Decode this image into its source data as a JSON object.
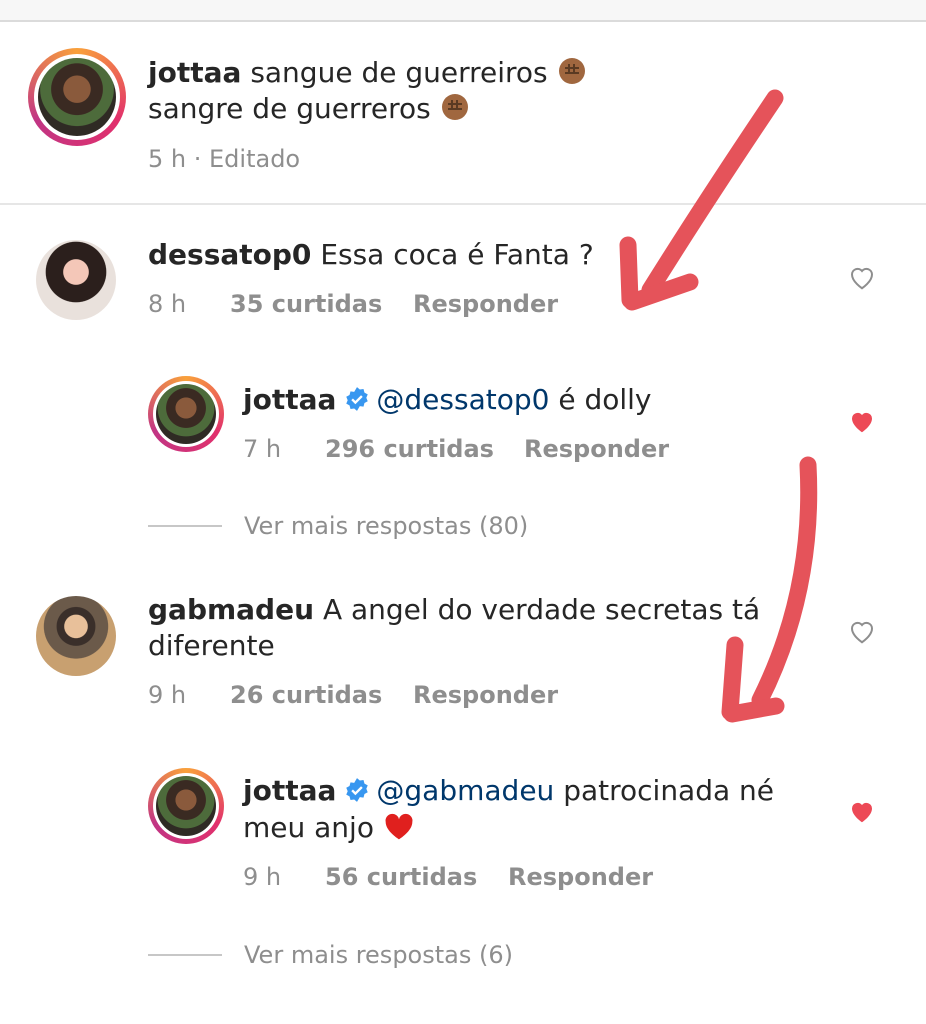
{
  "caption": {
    "username": "jottaa",
    "line1": "sangue de guerreiros",
    "line2": "sangre de guerreros",
    "time": "5 h",
    "edited": "· Editado"
  },
  "comments": [
    {
      "username": "dessatop0",
      "text": "Essa coca é Fanta ?",
      "time": "8 h",
      "likes": "35 curtidas",
      "reply_label": "Responder",
      "liked": false,
      "reply": {
        "username": "jottaa",
        "mention": "@dessatop0",
        "text": "é dolly",
        "time": "7 h",
        "likes": "296 curtidas",
        "reply_label": "Responder",
        "liked": true
      },
      "more_replies": "Ver mais respostas (80)"
    },
    {
      "username": "gabmadeu",
      "text_line1": "A angel do verdade secretas tá",
      "text_line2": "diferente",
      "time": "9 h",
      "likes": "26 curtidas",
      "reply_label": "Responder",
      "liked": false,
      "reply": {
        "username": "jottaa",
        "mention": "@gabmadeu",
        "text_line1": "patrocinada né",
        "text_line2": "meu anjo",
        "time": "9 h",
        "likes": "56 curtidas",
        "reply_label": "Responder",
        "liked": true
      },
      "more_replies": "Ver mais respostas (6)"
    }
  ],
  "colors": {
    "accent_heart": "#ed4956",
    "mention": "#00376b",
    "verified": "#3897f0",
    "annotation_arrow": "#e5535a"
  }
}
